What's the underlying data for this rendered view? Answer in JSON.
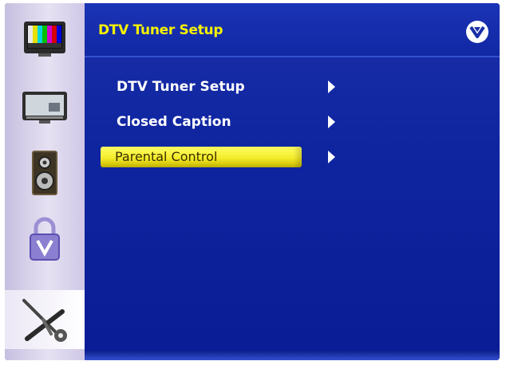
{
  "header": {
    "title": "DTV Tuner Setup",
    "logo_icon": "vizio-v-logo-icon"
  },
  "sidebar": {
    "items": [
      {
        "name": "picture",
        "icon": "tv-color-bars-icon"
      },
      {
        "name": "display",
        "icon": "monitor-icon"
      },
      {
        "name": "audio",
        "icon": "speaker-icon"
      },
      {
        "name": "parental-lock",
        "icon": "padlock-icon"
      },
      {
        "name": "setup",
        "icon": "wrench-tools-icon",
        "active": true
      }
    ]
  },
  "menu": {
    "items": [
      {
        "label": "DTV Tuner Setup"
      },
      {
        "label": "Closed Caption"
      },
      {
        "label": "Parental Control",
        "selected": true
      }
    ]
  },
  "colors": {
    "panel_blue": "#0f25a0",
    "title_yellow": "#f6f200",
    "highlight_yellow": "#f4ec2a",
    "sidebar_lavender": "#d8d1ec"
  }
}
